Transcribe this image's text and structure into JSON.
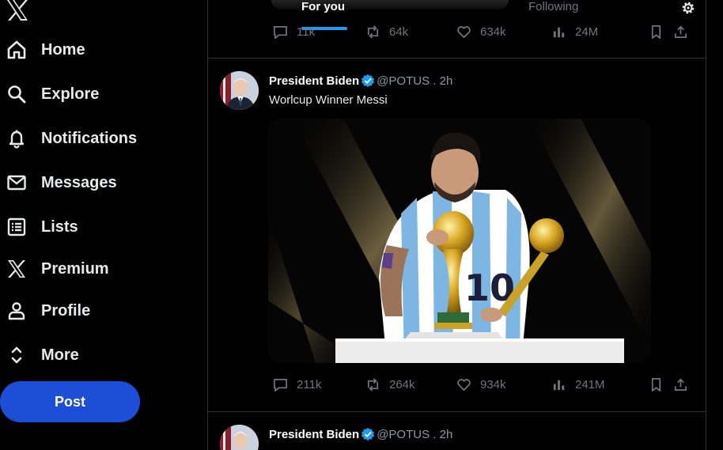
{
  "nav": {
    "items": [
      {
        "label": "Home",
        "icon": "home-icon"
      },
      {
        "label": "Explore",
        "icon": "search-icon"
      },
      {
        "label": "Notifications",
        "icon": "bell-icon"
      },
      {
        "label": "Messages",
        "icon": "envelope-icon"
      },
      {
        "label": "Lists",
        "icon": "list-icon"
      },
      {
        "label": "Premium",
        "icon": "x-logo-icon"
      },
      {
        "label": "Profile",
        "icon": "person-icon"
      },
      {
        "label": "More",
        "icon": "more-chevrons-icon"
      }
    ],
    "post_label": "Post"
  },
  "tabs": {
    "for_you": "For you",
    "following": "Following"
  },
  "top_tweet": {
    "stats": {
      "replies": "11k",
      "reposts": "64k",
      "likes": "634k",
      "views": "24M"
    }
  },
  "tweets": [
    {
      "name": "President Biden",
      "handle": "@POTUS . 2h",
      "text": "Worlcup Winner Messi",
      "stats": {
        "replies": "211k",
        "reposts": "264k",
        "likes": "934k",
        "views": "241M"
      }
    },
    {
      "name": "President Biden",
      "handle": "@POTUS . 2h"
    }
  ],
  "colors": {
    "accent": "#1d9bf0",
    "post_button": "#1d4ed8",
    "border": "#2f3336",
    "muted": "#71767b"
  }
}
